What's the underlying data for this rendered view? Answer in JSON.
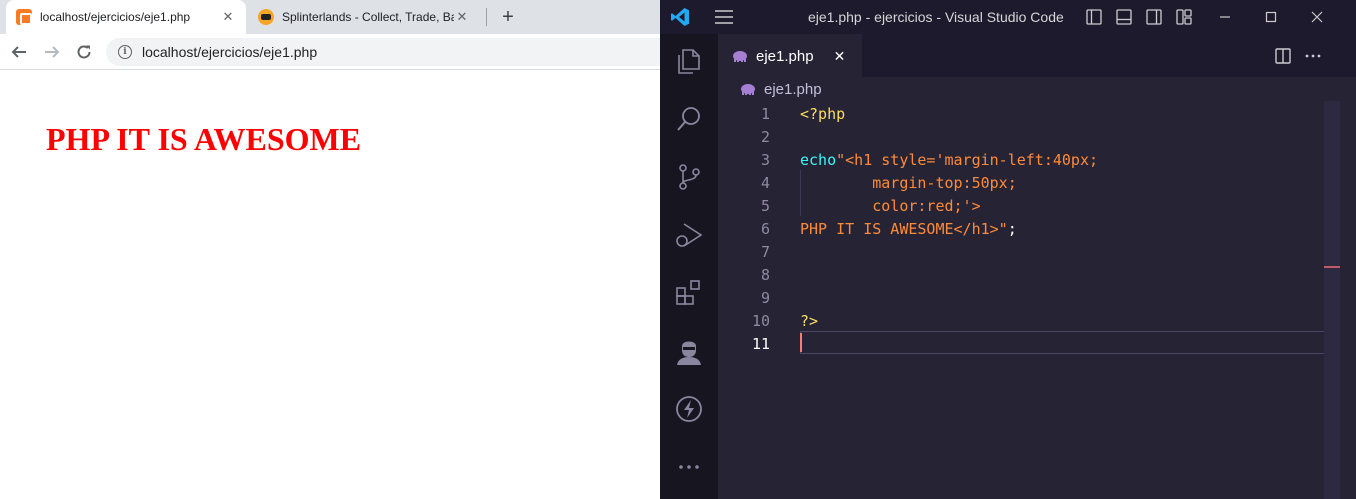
{
  "browser": {
    "tabs": [
      {
        "title": "localhost/ejercicios/eje1.php",
        "icon": "xampp-icon"
      },
      {
        "title": "Splinterlands - Collect, Trade, Bat",
        "icon": "splinterlands-icon"
      }
    ],
    "url": "localhost/ejercicios/eje1.php",
    "page_heading": "PHP IT IS AWESOME"
  },
  "vscode": {
    "window_title": "eje1.php - ejercicios - Visual Studio Code",
    "tab_label": "eje1.php",
    "breadcrumb": "eje1.php",
    "lines": [
      {
        "n": "1"
      },
      {
        "n": "2"
      },
      {
        "n": "3"
      },
      {
        "n": "4"
      },
      {
        "n": "5"
      },
      {
        "n": "6"
      },
      {
        "n": "7"
      },
      {
        "n": "8"
      },
      {
        "n": "9"
      },
      {
        "n": "10"
      },
      {
        "n": "11"
      }
    ],
    "code": {
      "l1": "<?php",
      "l3_fn": "echo",
      "l3_str": "\"<h1 style='margin-left:40px;",
      "l4": "        margin-top:50px;",
      "l5": "        color:red;'>",
      "l6_str": "PHP IT IS AWESOME</h1>\"",
      "l6_end": ";",
      "l10": "?>"
    },
    "colors": {
      "background": "#262335",
      "keyword": "#f97e72",
      "php_tag": "#fede5d",
      "function": "#36f9f6",
      "string": "#ff8b39"
    }
  }
}
